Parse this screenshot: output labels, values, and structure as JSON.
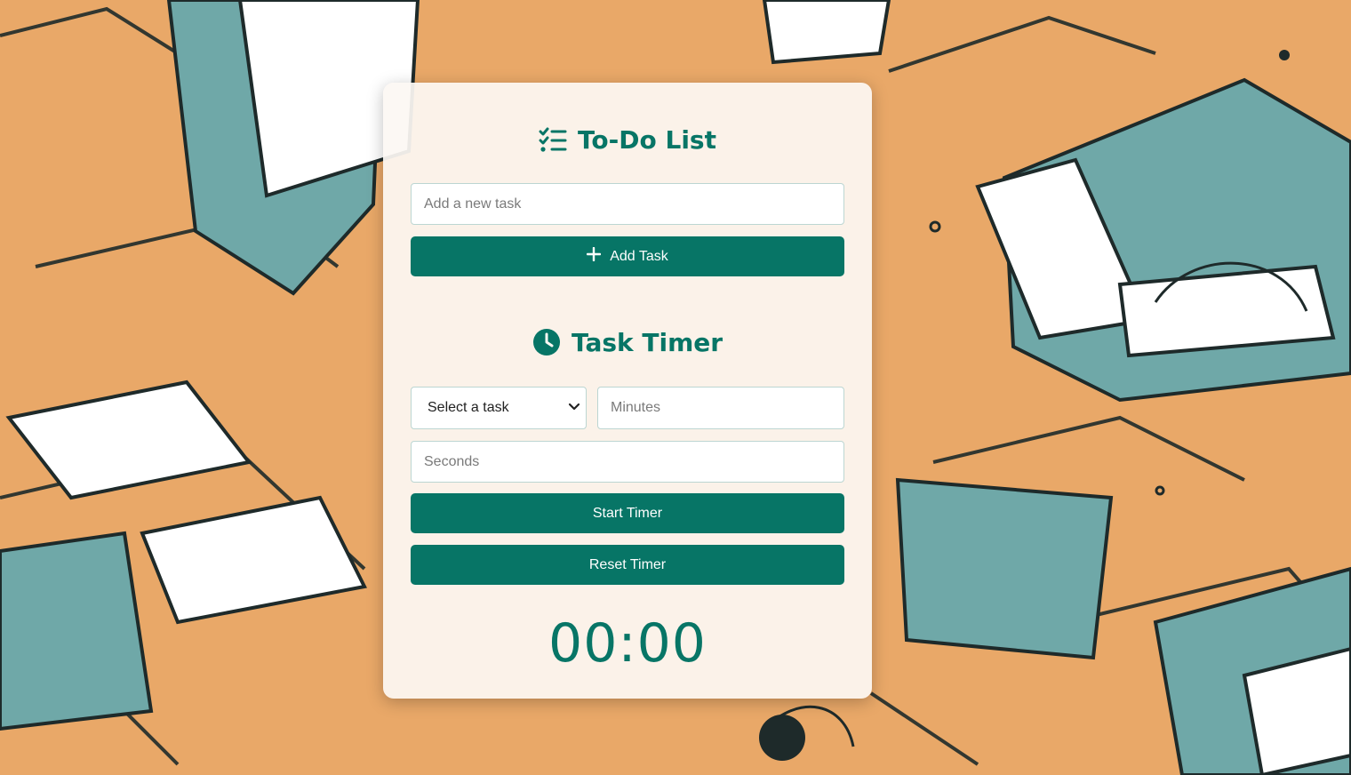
{
  "todo": {
    "title": "To-Do List",
    "title_icon": "list-check-icon",
    "task_input": {
      "placeholder": "Add a new task",
      "value": ""
    },
    "add_button": {
      "label": "Add Task",
      "icon": "plus-icon"
    }
  },
  "timer": {
    "title": "Task Timer",
    "title_icon": "clock-icon",
    "task_select": {
      "selected": "Select a task",
      "icon": "chevron-down-icon"
    },
    "minutes_input": {
      "placeholder": "Minutes",
      "value": ""
    },
    "seconds_input": {
      "placeholder": "Seconds",
      "value": ""
    },
    "start_button": {
      "label": "Start Timer"
    },
    "reset_button": {
      "label": "Reset Timer"
    },
    "display": "00:00"
  },
  "colors": {
    "accent": "#077566",
    "background": "#e9a868",
    "card": "#fcf8f3"
  }
}
